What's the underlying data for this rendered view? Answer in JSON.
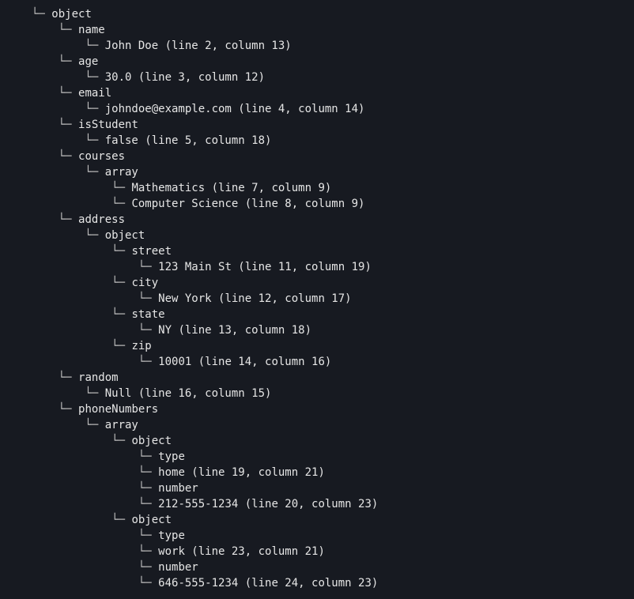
{
  "treeLines": [
    {
      "indent": 0,
      "text": "object"
    },
    {
      "indent": 1,
      "text": "name"
    },
    {
      "indent": 2,
      "text": "John Doe (line 2, column 13)"
    },
    {
      "indent": 1,
      "text": "age"
    },
    {
      "indent": 2,
      "text": "30.0 (line 3, column 12)"
    },
    {
      "indent": 1,
      "text": "email"
    },
    {
      "indent": 2,
      "text": "johndoe@example.com (line 4, column 14)"
    },
    {
      "indent": 1,
      "text": "isStudent"
    },
    {
      "indent": 2,
      "text": "false (line 5, column 18)"
    },
    {
      "indent": 1,
      "text": "courses"
    },
    {
      "indent": 2,
      "text": "array"
    },
    {
      "indent": 3,
      "text": "Mathematics (line 7, column 9)"
    },
    {
      "indent": 3,
      "text": "Computer Science (line 8, column 9)"
    },
    {
      "indent": 1,
      "text": "address"
    },
    {
      "indent": 2,
      "text": "object"
    },
    {
      "indent": 3,
      "text": "street"
    },
    {
      "indent": 4,
      "text": "123 Main St (line 11, column 19)"
    },
    {
      "indent": 3,
      "text": "city"
    },
    {
      "indent": 4,
      "text": "New York (line 12, column 17)"
    },
    {
      "indent": 3,
      "text": "state"
    },
    {
      "indent": 4,
      "text": "NY (line 13, column 18)"
    },
    {
      "indent": 3,
      "text": "zip"
    },
    {
      "indent": 4,
      "text": "10001 (line 14, column 16)"
    },
    {
      "indent": 1,
      "text": "random"
    },
    {
      "indent": 2,
      "text": "Null (line 16, column 15)"
    },
    {
      "indent": 1,
      "text": "phoneNumbers"
    },
    {
      "indent": 2,
      "text": "array"
    },
    {
      "indent": 3,
      "text": "object"
    },
    {
      "indent": 4,
      "text": "type"
    },
    {
      "indent": 4,
      "text": "home (line 19, column 21)"
    },
    {
      "indent": 4,
      "text": "number"
    },
    {
      "indent": 4,
      "text": "212-555-1234 (line 20, column 23)"
    },
    {
      "indent": 3,
      "text": "object"
    },
    {
      "indent": 4,
      "text": "type"
    },
    {
      "indent": 4,
      "text": "work (line 23, column 21)"
    },
    {
      "indent": 4,
      "text": "number"
    },
    {
      "indent": 4,
      "text": "646-555-1234 (line 24, column 23)"
    }
  ],
  "branchGlyph": "└─",
  "pipeGlyph": "│",
  "indentUnit": "    "
}
